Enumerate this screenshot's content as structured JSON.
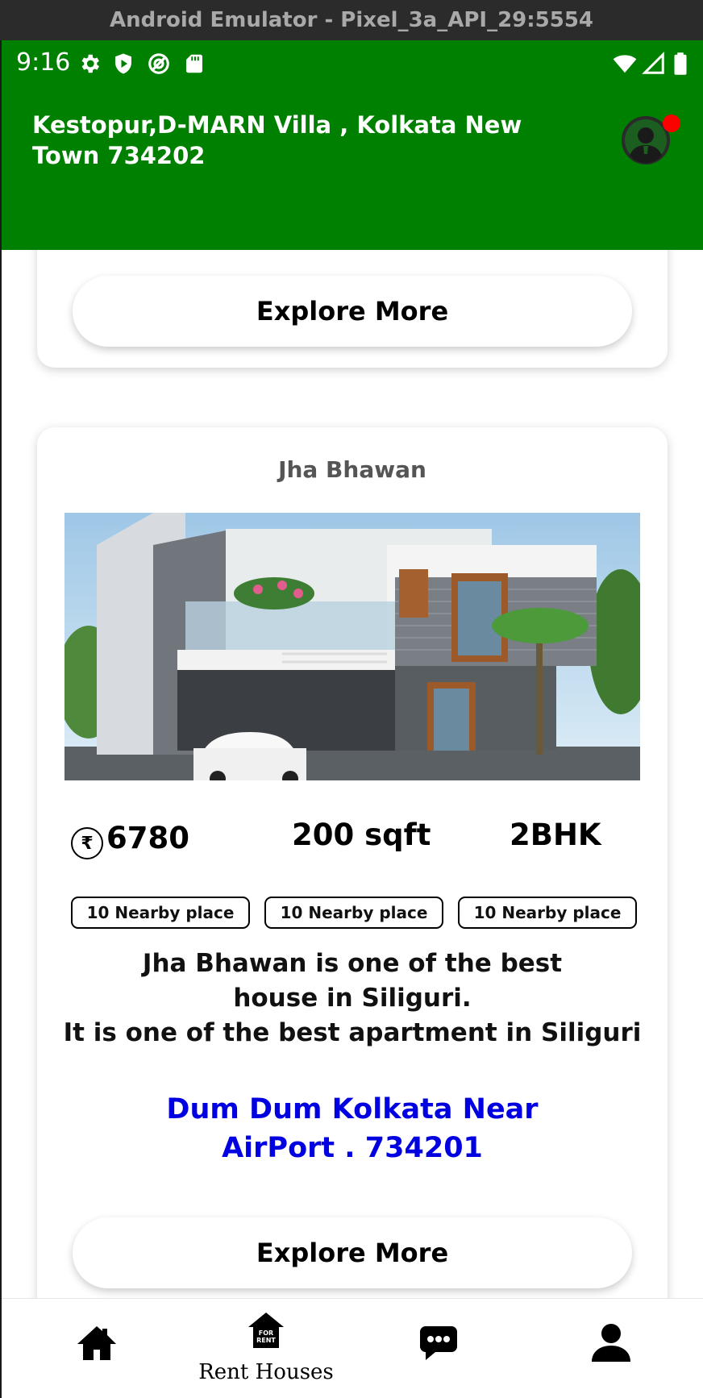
{
  "window": {
    "title": "Android Emulator - Pixel_3a_API_29:5554"
  },
  "status_bar": {
    "time": "9:16",
    "left_icons": [
      "settings-icon",
      "shield-play-icon",
      "no-tracking-icon",
      "sd-card-icon"
    ],
    "right_icons": [
      "wifi-icon",
      "signal-icon",
      "battery-icon"
    ]
  },
  "header": {
    "location": "Kestopur,D-MARN Villa , Kolkata New Town 734202",
    "avatar_icon": "user-avatar-icon",
    "notification_color": "#ff0000"
  },
  "colors": {
    "primary": "#008000",
    "address": "#0000e0"
  },
  "prev_card": {
    "explore_label": "Explore More"
  },
  "listing": {
    "title": "Jha Bhawan",
    "image_icon": "house-photo",
    "price": "6780",
    "area": "200 sqft",
    "bhk": "2BHK",
    "chips": [
      "10 Nearby place",
      "10 Nearby place",
      "10 Nearby place"
    ],
    "description_line1": "Jha Bhawan is one of the best house in Siliguri.",
    "description_line2": "It is one of the best apartment in Siliguri",
    "address": "Dum Dum Kolkata Near AirPort . 734201",
    "explore_label": "Explore More"
  },
  "bottom_nav": {
    "items": [
      {
        "icon": "home-icon",
        "label": ""
      },
      {
        "icon": "for-rent-icon",
        "label": "Rent Houses"
      },
      {
        "icon": "chat-icon",
        "label": ""
      },
      {
        "icon": "profile-icon",
        "label": ""
      }
    ],
    "active_index": 1
  }
}
